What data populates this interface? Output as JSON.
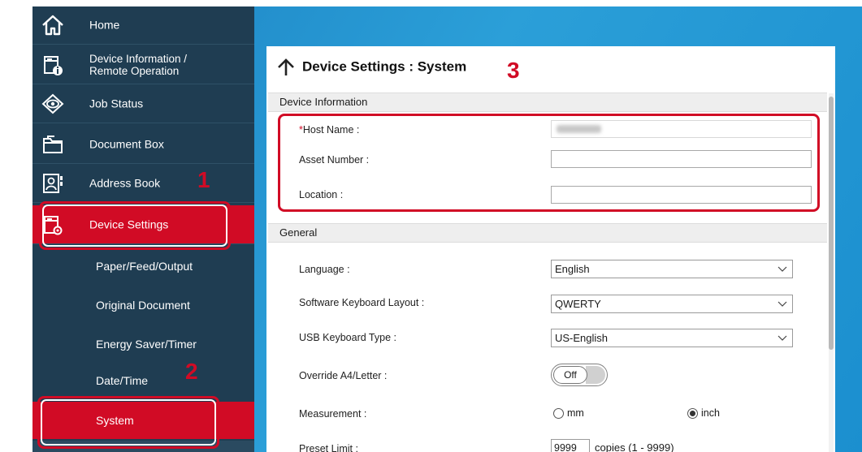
{
  "sidebar": {
    "items": [
      {
        "label": "Home",
        "icon": "home-icon"
      },
      {
        "label_line1": "Device Information /",
        "label_line2": "Remote Operation",
        "icon": "device-info-icon"
      },
      {
        "label": "Job Status",
        "icon": "eye-icon"
      },
      {
        "label": "Document Box",
        "icon": "folder-icon"
      },
      {
        "label": "Address Book",
        "icon": "address-book-icon"
      },
      {
        "label": "Device Settings",
        "icon": "device-settings-icon",
        "active": true
      }
    ],
    "subitems": [
      {
        "label": "Paper/Feed/Output"
      },
      {
        "label": "Original Document"
      },
      {
        "label": "Energy Saver/Timer"
      },
      {
        "label": "Date/Time"
      },
      {
        "label": "System",
        "active": true
      }
    ]
  },
  "callouts": {
    "one": "1",
    "two": "2",
    "three": "3"
  },
  "panel": {
    "title": "Device Settings : System",
    "device_information": {
      "header": "Device Information",
      "host_name_required": "*",
      "host_name_label": "Host Name :",
      "asset_number_label": "Asset Number :",
      "location_label": "Location :"
    },
    "general": {
      "header": "General",
      "language_label": "Language :",
      "language_value": "English",
      "keyboard_layout_label": "Software Keyboard Layout :",
      "keyboard_layout_value": "QWERTY",
      "usb_keyboard_label": "USB Keyboard Type :",
      "usb_keyboard_value": "US-English",
      "override_label": "Override A4/Letter :",
      "override_value": "Off",
      "measurement_label": "Measurement :",
      "measurement_options": [
        "mm",
        "inch"
      ],
      "measurement_selected": "inch",
      "preset_limit_label": "Preset Limit :",
      "preset_limit_value": "9999",
      "preset_limit_suffix": "copies (1 - 9999)"
    }
  },
  "colors": {
    "accent": "#d10b25",
    "sidebar_bg": "#1f3d52",
    "desktop_blue": "#2b9fd8"
  }
}
